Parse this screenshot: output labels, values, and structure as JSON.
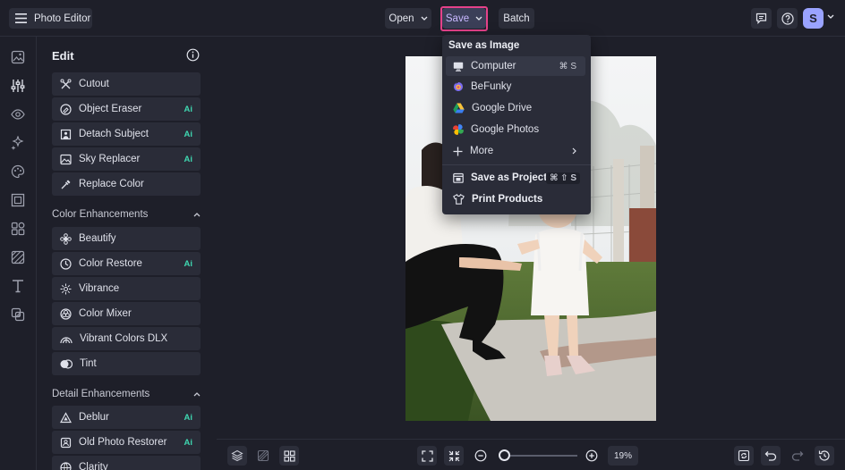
{
  "app": {
    "title": "Photo Editor"
  },
  "toolbar": {
    "open_label": "Open",
    "save_label": "Save",
    "batch_label": "Batch"
  },
  "user": {
    "avatar_letter": "S",
    "accent": "#9aa3ff"
  },
  "panel": {
    "title": "Edit",
    "items_top": [
      {
        "label": "Cutout",
        "icon": "cutout-icon",
        "ai": ""
      },
      {
        "label": "Object Eraser",
        "icon": "eraser-icon",
        "ai": "Ai"
      },
      {
        "label": "Detach Subject",
        "icon": "detach-icon",
        "ai": "Ai"
      },
      {
        "label": "Sky Replacer",
        "icon": "sky-icon",
        "ai": "Ai"
      },
      {
        "label": "Replace Color",
        "icon": "dropper-icon",
        "ai": ""
      }
    ],
    "section_color": "Color Enhancements",
    "items_color": [
      {
        "label": "Beautify",
        "icon": "beautify-icon",
        "ai": ""
      },
      {
        "label": "Color Restore",
        "icon": "color-restore-icon",
        "ai": "Ai"
      },
      {
        "label": "Vibrance",
        "icon": "vibrance-icon",
        "ai": ""
      },
      {
        "label": "Color Mixer",
        "icon": "color-mixer-icon",
        "ai": ""
      },
      {
        "label": "Vibrant Colors DLX",
        "icon": "rainbow-icon",
        "ai": ""
      },
      {
        "label": "Tint",
        "icon": "tint-icon",
        "ai": ""
      }
    ],
    "section_detail": "Detail Enhancements",
    "items_detail": [
      {
        "label": "Deblur",
        "icon": "deblur-icon",
        "ai": "Ai"
      },
      {
        "label": "Old Photo Restorer",
        "icon": "photo-restore-icon",
        "ai": "Ai"
      },
      {
        "label": "Clarity",
        "icon": "clarity-icon",
        "ai": ""
      }
    ]
  },
  "dropdown": {
    "heading": "Save as Image",
    "items": [
      {
        "label": "Computer",
        "icon": "monitor-icon",
        "shortcut": "⌘ S"
      },
      {
        "label": "BeFunky",
        "icon": "befunky-icon"
      },
      {
        "label": "Google Drive",
        "icon": "google-drive-icon"
      },
      {
        "label": "Google Photos",
        "icon": "google-photos-icon"
      },
      {
        "label": "More",
        "icon": "plus-icon"
      }
    ],
    "project": {
      "label": "Save as Project",
      "shortcut": "⌘ ⇧ S"
    },
    "print": {
      "label": "Print Products"
    }
  },
  "zoom": {
    "value": "19%",
    "level": 0.19
  },
  "colors": {
    "background": "#1e1f29",
    "panel_item": "#2a2c38",
    "ai_badge": "#3fd6b0",
    "save_highlight": "#e5428a"
  }
}
